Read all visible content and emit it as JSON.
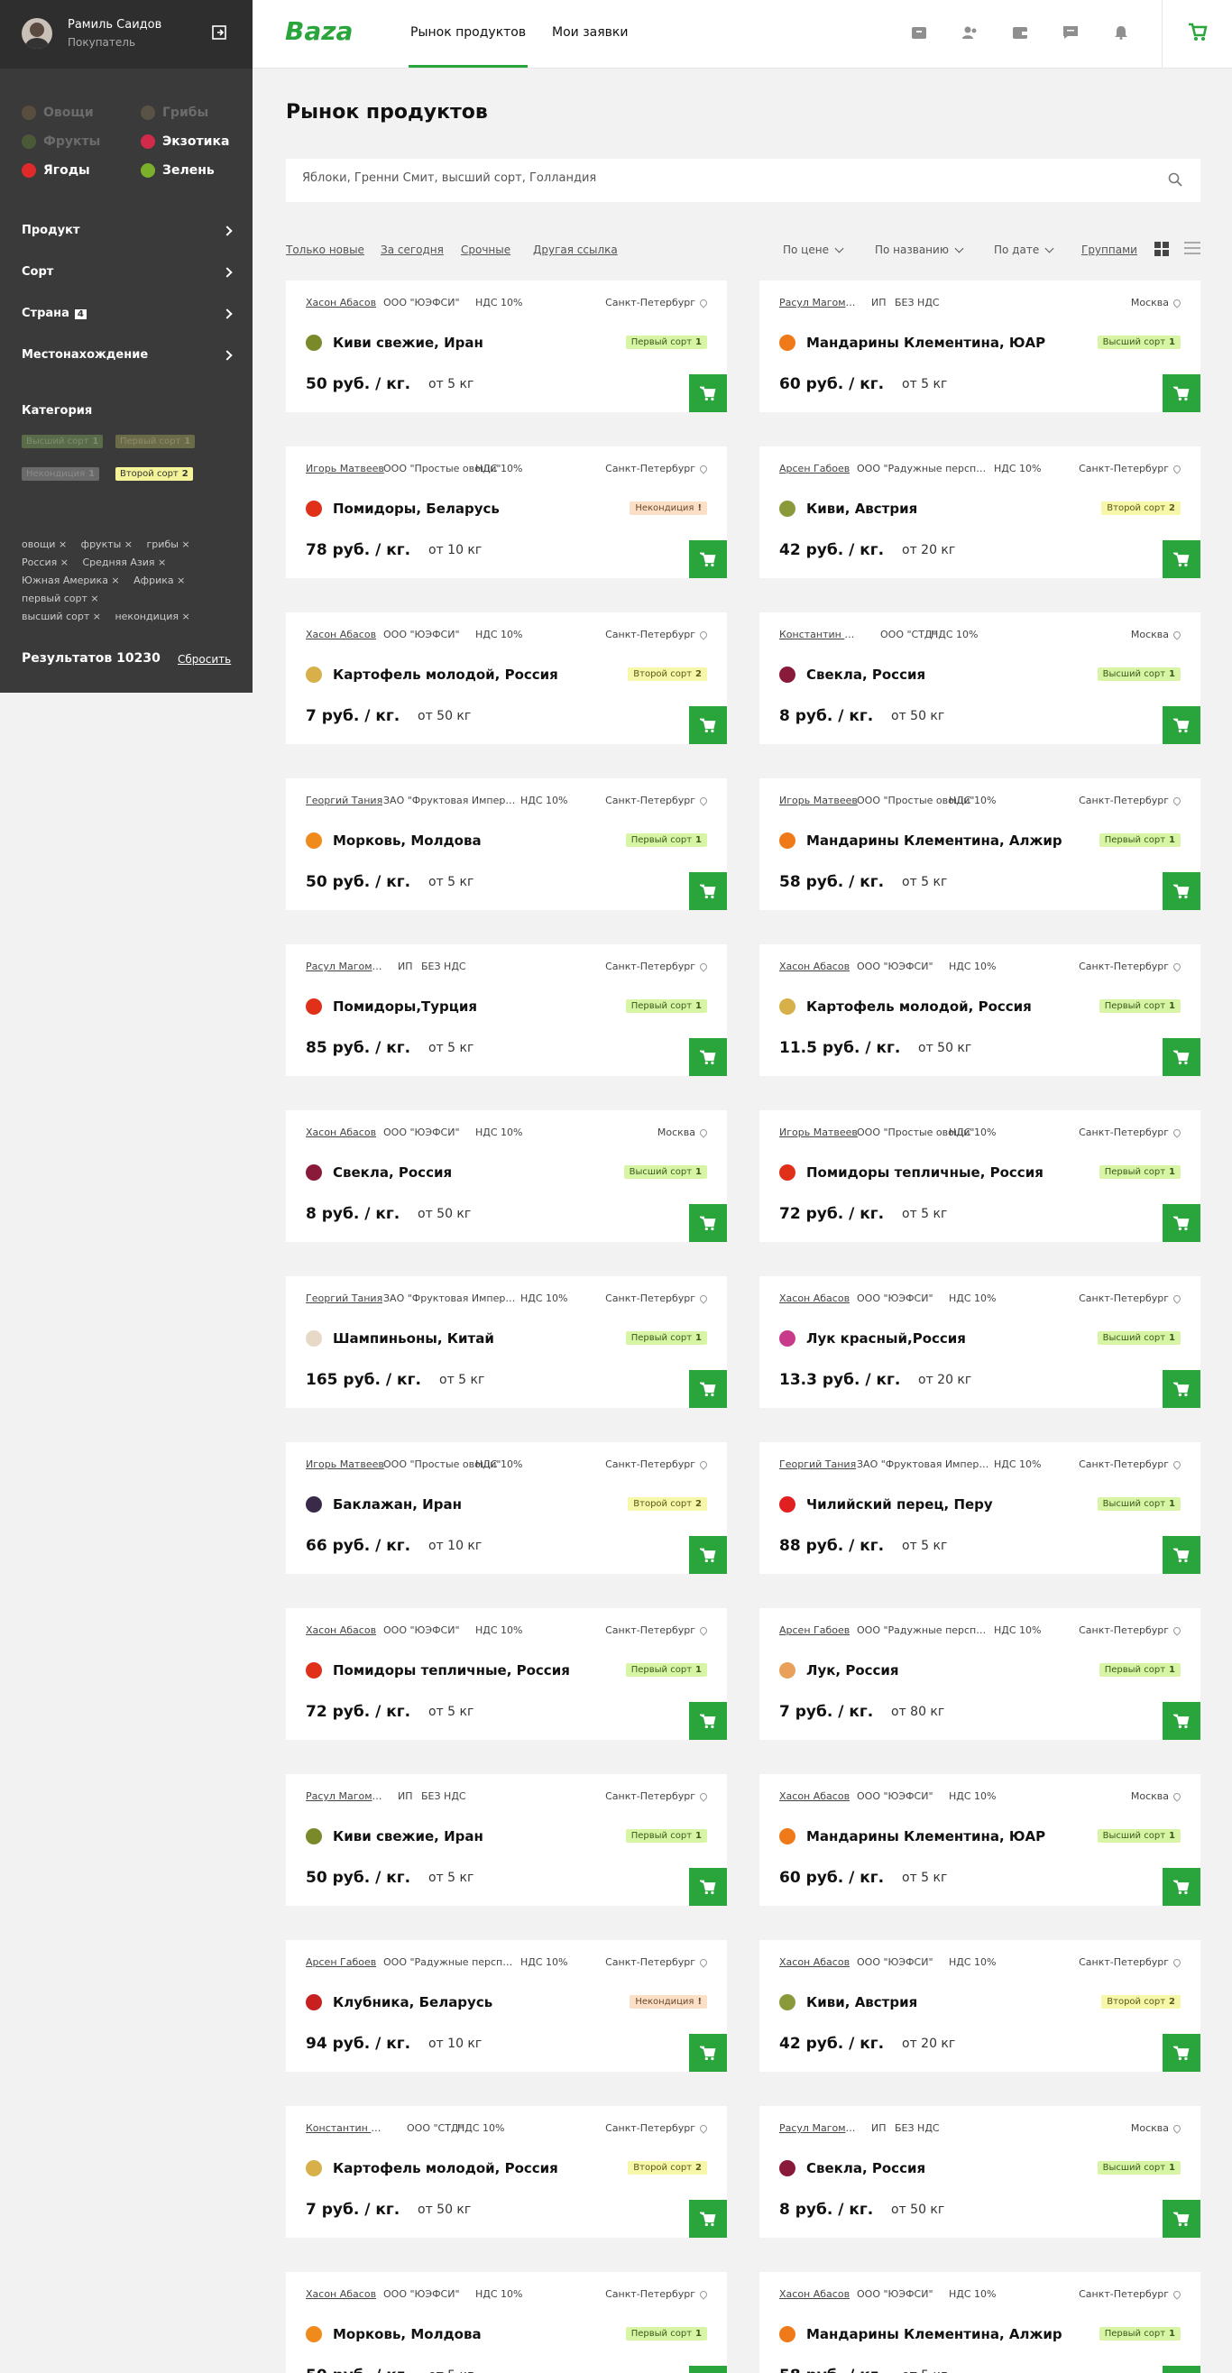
{
  "user": {
    "name": "Рамиль Саидов",
    "role": "Покупатель"
  },
  "categories": [
    {
      "label": "Овощи",
      "color": "#8a6b4a",
      "dim": true
    },
    {
      "label": "Грибы",
      "color": "#8a7a5a",
      "dim": true
    },
    {
      "label": "Фрукты",
      "color": "#6a8a3a",
      "dim": true
    },
    {
      "label": "Экзотика",
      "color": "#d12a4a",
      "dim": false
    },
    {
      "label": "Ягоды",
      "color": "#e02a2a",
      "dim": false
    },
    {
      "label": "Зелень",
      "color": "#7ab02a",
      "dim": false
    }
  ],
  "menu": [
    {
      "label": "Продукт",
      "badge": ""
    },
    {
      "label": "Сорт",
      "badge": ""
    },
    {
      "label": "Страна",
      "badge": "4"
    },
    {
      "label": "Местонахождение",
      "badge": ""
    }
  ],
  "category_title": "Категория",
  "grade_tags": [
    {
      "label": "Высший сорт",
      "num": "1"
    },
    {
      "label": "Первый сорт",
      "num": "1"
    },
    {
      "label": "Некондиция",
      "num": "1"
    },
    {
      "label": "Второй сорт",
      "num": "2"
    }
  ],
  "active_filters": [
    "овощи",
    "фрукты",
    "грибы",
    "Россия",
    "Средняя Азия",
    "Южная Америка",
    "Африка",
    "первый сорт",
    "высший сорт",
    "некондиция"
  ],
  "results": {
    "label": "Результатов 10230",
    "reset": "Сбросить"
  },
  "header": {
    "logo": "Baza",
    "nav": [
      "Рынок продуктов",
      "Мои заявки"
    ]
  },
  "page_title": "Рынок продуктов",
  "search": {
    "value": "Яблоки, Гренни Смит, высший сорт, Голландия"
  },
  "quick_links": [
    "Только новые",
    "За сегодня",
    "Срочные",
    "Другая ссылка"
  ],
  "sorts": [
    "По цене",
    "По названию",
    "По дате"
  ],
  "group_label": "Группами",
  "colors": {
    "accent": "#2aa53c",
    "sidebar": "#3a3a3a"
  },
  "cards": [
    {
      "seller": "Хасон Абасов",
      "org": "ООО \"ЮЭФСИ\"",
      "vat": "НДС 10%",
      "city": "Санкт-Петербург",
      "name": "Киви свежие, Иран",
      "icon": "#7a8a2a",
      "grade": "Первый сорт",
      "gnum": "1",
      "gclass": "g1",
      "price": "50 руб. / кг.",
      "min": "от 5 кг"
    },
    {
      "seller": "Расул Магомедов",
      "org": "ИП",
      "vat": "БЕЗ НДС",
      "city": "Москва",
      "name": "Мандарины Клементина, ЮАР",
      "icon": "#f07a1a",
      "grade": "Высший сорт",
      "gnum": "1",
      "gclass": "g1",
      "price": "60 руб. / кг.",
      "min": "от 5 кг"
    },
    {
      "seller": "Игорь Матвеев",
      "org": "ООО \"Простые овощи\"",
      "vat": "НДС 10%",
      "city": "Санкт-Петербург",
      "name": "Помидоры, Беларусь",
      "icon": "#e0301a",
      "grade": "Некондиция",
      "gnum": "!",
      "gclass": "gx",
      "price": "78 руб. / кг.",
      "min": "от 10 кг"
    },
    {
      "seller": "Арсен Габоев",
      "org": "ООО \"Радужные перспек...",
      "vat": "НДС 10%",
      "city": "Санкт-Петербург",
      "name": "Киви, Австрия",
      "icon": "#8a9a3a",
      "grade": "Второй сорт",
      "gnum": "2",
      "gclass": "g2",
      "price": "42 руб. / кг.",
      "min": "от 20 кг"
    },
    {
      "seller": "Хасон Абасов",
      "org": "ООО \"ЮЭФСИ\"",
      "vat": "НДС 10%",
      "city": "Санкт-Петербург",
      "name": "Картофель молодой, Россия",
      "icon": "#d8b04a",
      "grade": "Второй сорт",
      "gnum": "2",
      "gclass": "g2",
      "price": "7 руб. / кг.",
      "min": "от 50 кг"
    },
    {
      "seller": "Константин Консто...",
      "org": "ООО \"СТД\"",
      "vat": "НДС 10%",
      "city": "Москва",
      "name": "Свекла, Россия",
      "icon": "#8a1a3a",
      "grade": "Высший сорт",
      "gnum": "1",
      "gclass": "g1",
      "price": "8 руб. / кг.",
      "min": "от 50 кг"
    },
    {
      "seller": "Георгий Тания",
      "org": "ЗАО \"Фруктовая Империя\"",
      "vat": "НДС 10%",
      "city": "Санкт-Петербург",
      "name": "Морковь, Молдова",
      "icon": "#f08a1a",
      "grade": "Первый сорт",
      "gnum": "1",
      "gclass": "g1",
      "price": "50 руб. / кг.",
      "min": "от 5 кг"
    },
    {
      "seller": "Игорь Матвеев",
      "org": "ООО \"Простые овощи\"",
      "vat": "НДС 10%",
      "city": "Санкт-Петербург",
      "name": "Мандарины Клементина, Алжир",
      "icon": "#f07a1a",
      "grade": "Первый сорт",
      "gnum": "1",
      "gclass": "g1",
      "price": "58 руб. / кг.",
      "min": "от 5 кг"
    },
    {
      "seller": "Расул Магомедов",
      "org": "ИП",
      "vat": "БЕЗ НДС",
      "city": "Санкт-Петербург",
      "name": "Помидоры,Турция",
      "icon": "#e0301a",
      "grade": "Первый сорт",
      "gnum": "1",
      "gclass": "g1",
      "price": "85 руб. / кг.",
      "min": "от 5 кг"
    },
    {
      "seller": "Хасон Абасов",
      "org": "ООО \"ЮЭФСИ\"",
      "vat": "НДС 10%",
      "city": "Санкт-Петербург",
      "name": "Картофель молодой, Россия",
      "icon": "#d8b04a",
      "grade": "Первый сорт",
      "gnum": "1",
      "gclass": "g1",
      "price": "11.5 руб. / кг.",
      "min": "от 50 кг"
    },
    {
      "seller": "Хасон Абасов",
      "org": "ООО \"ЮЭФСИ\"",
      "vat": "НДС 10%",
      "city": "Москва",
      "name": "Свекла, Россия",
      "icon": "#8a1a3a",
      "grade": "Высший сорт",
      "gnum": "1",
      "gclass": "g1",
      "price": "8 руб. / кг.",
      "min": "от 50 кг"
    },
    {
      "seller": "Игорь Матвеев",
      "org": "ООО \"Простые овощи\"",
      "vat": "НДС 10%",
      "city": "Санкт-Петербург",
      "name": "Помидоры тепличные, Россия",
      "icon": "#e0301a",
      "grade": "Первый сорт",
      "gnum": "1",
      "gclass": "g1",
      "price": "72 руб. / кг.",
      "min": "от 5 кг"
    },
    {
      "seller": "Георгий Тания",
      "org": "ЗАО \"Фруктовая Империя\"",
      "vat": "НДС 10%",
      "city": "Санкт-Петербург",
      "name": "Шампиньоны, Китай",
      "icon": "#e8d8c8",
      "grade": "Первый сорт",
      "gnum": "1",
      "gclass": "g1",
      "price": "165 руб. / кг.",
      "min": "от 5 кг"
    },
    {
      "seller": "Хасон Абасов",
      "org": "ООО \"ЮЭФСИ\"",
      "vat": "НДС 10%",
      "city": "Санкт-Петербург",
      "name": "Лук красный,Россия",
      "icon": "#c83a8a",
      "grade": "Высший сорт",
      "gnum": "1",
      "gclass": "g1",
      "price": "13.3 руб. / кг.",
      "min": "от 20 кг"
    },
    {
      "seller": "Игорь Матвеев",
      "org": "ООО \"Простые овощи\"",
      "vat": "НДС 10%",
      "city": "Санкт-Петербург",
      "name": "Баклажан, Иран",
      "icon": "#3a2a4a",
      "grade": "Второй сорт",
      "gnum": "2",
      "gclass": "g2",
      "price": "66 руб. / кг.",
      "min": "от 10 кг"
    },
    {
      "seller": "Георгий Тания",
      "org": "ЗАО \"Фруктовая Империя\"",
      "vat": "НДС 10%",
      "city": "Санкт-Петербург",
      "name": "Чилийский перец, Перу",
      "icon": "#e02020",
      "grade": "Высший сорт",
      "gnum": "1",
      "gclass": "g1",
      "price": "88 руб. / кг.",
      "min": "от 5 кг"
    },
    {
      "seller": "Хасон Абасов",
      "org": "ООО \"ЮЭФСИ\"",
      "vat": "НДС 10%",
      "city": "Санкт-Петербург",
      "name": "Помидоры тепличные, Россия",
      "icon": "#e0301a",
      "grade": "Первый сорт",
      "gnum": "1",
      "gclass": "g1",
      "price": "72 руб. / кг.",
      "min": "от 5 кг"
    },
    {
      "seller": "Арсен Габоев",
      "org": "ООО \"Радужные перспек...",
      "vat": "НДС 10%",
      "city": "Санкт-Петербург",
      "name": "Лук, Россия",
      "icon": "#e8a05a",
      "grade": "Первый сорт",
      "gnum": "1",
      "gclass": "g1",
      "price": "7 руб. / кг.",
      "min": "от 80 кг"
    },
    {
      "seller": "Расул Магомедов",
      "org": "ИП",
      "vat": "БЕЗ НДС",
      "city": "Санкт-Петербург",
      "name": "Киви свежие, Иран",
      "icon": "#7a8a2a",
      "grade": "Первый сорт",
      "gnum": "1",
      "gclass": "g1",
      "price": "50 руб. / кг.",
      "min": "от 5 кг"
    },
    {
      "seller": "Хасон Абасов",
      "org": "ООО \"ЮЭФСИ\"",
      "vat": "НДС 10%",
      "city": "Москва",
      "name": "Мандарины Клементина, ЮАР",
      "icon": "#f07a1a",
      "grade": "Высший сорт",
      "gnum": "1",
      "gclass": "g1",
      "price": "60 руб. / кг.",
      "min": "от 5 кг"
    },
    {
      "seller": "Арсен Габоев",
      "org": "ООО \"Радужные перспек...",
      "vat": "НДС 10%",
      "city": "Санкт-Петербург",
      "name": "Клубника, Беларусь",
      "icon": "#c82020",
      "grade": "Некондиция",
      "gnum": "!",
      "gclass": "gx",
      "price": "94 руб. / кг.",
      "min": "от 10 кг"
    },
    {
      "seller": "Хасон Абасов",
      "org": "ООО \"ЮЭФСИ\"",
      "vat": "НДС 10%",
      "city": "Санкт-Петербург",
      "name": "Киви, Австрия",
      "icon": "#8a9a3a",
      "grade": "Второй сорт",
      "gnum": "2",
      "gclass": "g2",
      "price": "42 руб. / кг.",
      "min": "от 20 кг"
    },
    {
      "seller": "Константин Консто...",
      "org": "ООО \"СТД\"",
      "vat": "НДС 10%",
      "city": "Санкт-Петербург",
      "name": "Картофель молодой, Россия",
      "icon": "#d8b04a",
      "grade": "Второй сорт",
      "gnum": "2",
      "gclass": "g2",
      "price": "7 руб. / кг.",
      "min": "от 50 кг"
    },
    {
      "seller": "Расул Магомедов",
      "org": "ИП",
      "vat": "БЕЗ НДС",
      "city": "Москва",
      "name": "Свекла, Россия",
      "icon": "#8a1a3a",
      "grade": "Высший сорт",
      "gnum": "1",
      "gclass": "g1",
      "price": "8 руб. / кг.",
      "min": "от 50 кг"
    },
    {
      "seller": "Хасон Абасов",
      "org": "ООО \"ЮЭФСИ\"",
      "vat": "НДС 10%",
      "city": "Санкт-Петербург",
      "name": "Морковь, Молдова",
      "icon": "#f08a1a",
      "grade": "Первый сорт",
      "gnum": "1",
      "gclass": "g1",
      "price": "50 руб. / кг.",
      "min": "от 5 кг"
    },
    {
      "seller": "Хасон Абасов",
      "org": "ООО \"ЮЭФСИ\"",
      "vat": "НДС 10%",
      "city": "Санкт-Петербург",
      "name": "Мандарины Клементина, Алжир",
      "icon": "#f07a1a",
      "grade": "Первый сорт",
      "gnum": "1",
      "gclass": "g1",
      "price": "58 руб. / кг.",
      "min": "от 5 кг"
    }
  ]
}
